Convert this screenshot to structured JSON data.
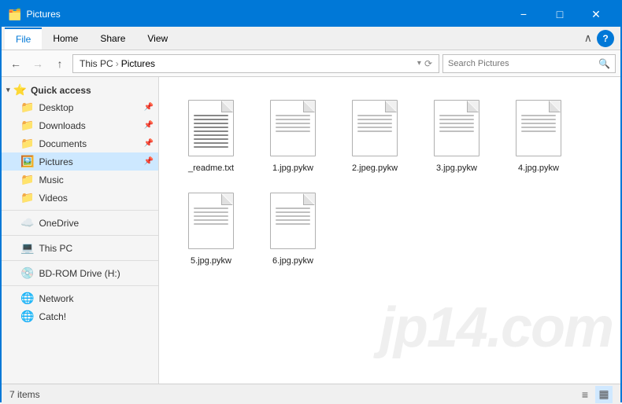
{
  "titleBar": {
    "title": "Pictures",
    "minimizeLabel": "−",
    "maximizeLabel": "□",
    "closeLabel": "✕"
  },
  "ribbon": {
    "tabs": [
      "File",
      "Home",
      "Share",
      "View"
    ],
    "activeTab": "File",
    "expandIcon": "∧",
    "helpLabel": "?"
  },
  "addressBar": {
    "backDisabled": false,
    "forwardDisabled": false,
    "upLabel": "↑",
    "pathParts": [
      "This PC",
      "Pictures"
    ],
    "dropdownLabel": "▾",
    "refreshLabel": "⟳",
    "searchPlaceholder": "Search Pictures",
    "searchIconLabel": "🔍"
  },
  "sidebar": {
    "quickAccessLabel": "Quick access",
    "quickAccessItems": [
      {
        "label": "Desktop",
        "pinned": true,
        "icon": "📁"
      },
      {
        "label": "Downloads",
        "pinned": true,
        "icon": "📁"
      },
      {
        "label": "Documents",
        "pinned": true,
        "icon": "📁"
      },
      {
        "label": "Pictures",
        "pinned": true,
        "icon": "🖼️",
        "active": true
      },
      {
        "label": "Music",
        "pinned": false,
        "icon": "📁"
      },
      {
        "label": "Videos",
        "pinned": false,
        "icon": "📁"
      }
    ],
    "cloudItems": [
      {
        "label": "OneDrive",
        "icon": "☁️"
      }
    ],
    "systemItems": [
      {
        "label": "This PC",
        "icon": "💻"
      }
    ],
    "driveItems": [
      {
        "label": "BD-ROM Drive (H:)",
        "icon": "💿"
      }
    ],
    "networkItems": [
      {
        "label": "Network",
        "icon": "🌐"
      },
      {
        "label": "Catch!",
        "icon": "🌐"
      }
    ]
  },
  "content": {
    "files": [
      {
        "name": "_readme.txt",
        "type": "txt"
      },
      {
        "name": "1.jpg.pykw",
        "type": "doc"
      },
      {
        "name": "2.jpeg.pykw",
        "type": "doc"
      },
      {
        "name": "3.jpg.pykw",
        "type": "doc"
      },
      {
        "name": "4.jpg.pykw",
        "type": "doc"
      },
      {
        "name": "5.jpg.pykw",
        "type": "doc"
      },
      {
        "name": "6.jpg.pykw",
        "type": "doc"
      }
    ],
    "watermark": "jp14.com"
  },
  "statusBar": {
    "itemCount": "7 items",
    "listViewIcon": "≡",
    "detailViewIcon": "▦"
  }
}
